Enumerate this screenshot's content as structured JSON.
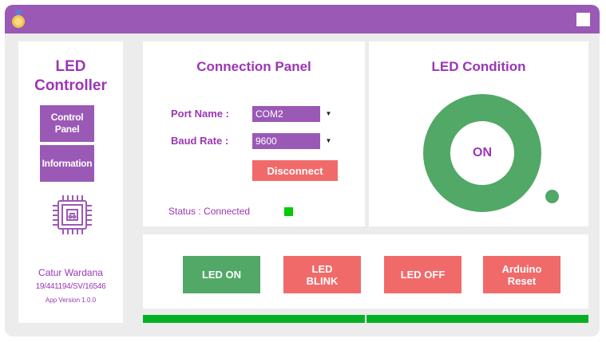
{
  "window": {
    "close_icon": "square-icon"
  },
  "sidebar": {
    "title_line1": "LED",
    "title_line2": "Controller",
    "nav": [
      {
        "label_line1": "Control",
        "label_line2": "Panel"
      },
      {
        "label": "Information"
      }
    ],
    "author_name": "Catur Wardana",
    "author_id": "19/441194/SV/16546",
    "app_version": "App Version 1.0.0"
  },
  "connection": {
    "title": "Connection Panel",
    "port_label": "Port Name :",
    "port_value": "COM2",
    "baud_label": "Baud Rate :",
    "baud_value": "9600",
    "disconnect_label": "Disconnect",
    "status_text": "Status : Connected",
    "status_color": "#00cc00"
  },
  "led": {
    "title": "LED Condition",
    "state": "ON",
    "ring_color": "#52a866"
  },
  "actions": {
    "led_on": "LED ON",
    "led_blink_1": "LED",
    "led_blink_2": "BLINK",
    "led_off": "LED OFF",
    "reset_1": "Arduino",
    "reset_2": "Reset"
  },
  "colors": {
    "accent": "#9b59b6",
    "title_text": "#9b36b5",
    "danger": "#f16a6a",
    "success": "#52a866",
    "progress": "#06b025"
  },
  "progress": {
    "fraction": 1.0
  }
}
